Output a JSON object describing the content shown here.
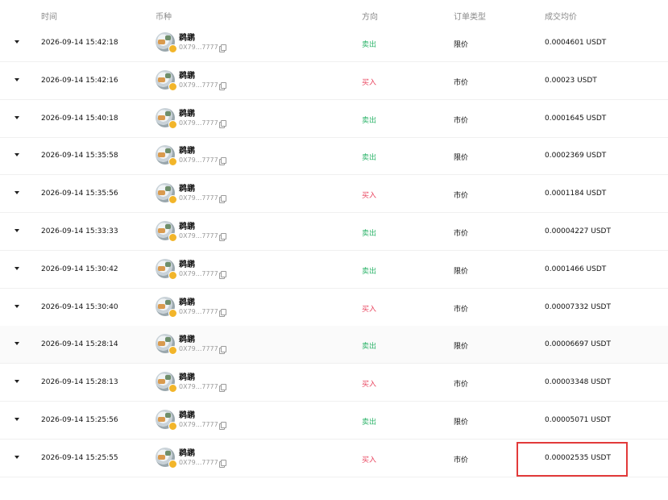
{
  "header": {
    "time": "时间",
    "coin": "币种",
    "direction": "方向",
    "order_type": "订单类型",
    "avg_price": "成交均价"
  },
  "colors": {
    "sell": "#2fb46b",
    "buy": "#e9445e",
    "highlight_box": "#e23a3a"
  },
  "rows": [
    {
      "time": "2026-09-14 15:42:18",
      "coin": "鹈鹕",
      "address": "0X79...7777",
      "direction": "卖出",
      "side": "sell",
      "order_type": "限价",
      "avg_price": "0.0004601 USDT"
    },
    {
      "time": "2026-09-14 15:42:16",
      "coin": "鹈鹕",
      "address": "0X79...7777",
      "direction": "买入",
      "side": "buy",
      "order_type": "市价",
      "avg_price": "0.00023 USDT"
    },
    {
      "time": "2026-09-14 15:40:18",
      "coin": "鹈鹕",
      "address": "0X79...7777",
      "direction": "卖出",
      "side": "sell",
      "order_type": "市价",
      "avg_price": "0.0001645 USDT"
    },
    {
      "time": "2026-09-14 15:35:58",
      "coin": "鹈鹕",
      "address": "0X79...7777",
      "direction": "卖出",
      "side": "sell",
      "order_type": "限价",
      "avg_price": "0.0002369 USDT"
    },
    {
      "time": "2026-09-14 15:35:56",
      "coin": "鹈鹕",
      "address": "0X79...7777",
      "direction": "买入",
      "side": "buy",
      "order_type": "市价",
      "avg_price": "0.0001184 USDT"
    },
    {
      "time": "2026-09-14 15:33:33",
      "coin": "鹈鹕",
      "address": "0X79...7777",
      "direction": "卖出",
      "side": "sell",
      "order_type": "市价",
      "avg_price": "0.00004227 USDT"
    },
    {
      "time": "2026-09-14 15:30:42",
      "coin": "鹈鹕",
      "address": "0X79...7777",
      "direction": "卖出",
      "side": "sell",
      "order_type": "限价",
      "avg_price": "0.0001466 USDT"
    },
    {
      "time": "2026-09-14 15:30:40",
      "coin": "鹈鹕",
      "address": "0X79...7777",
      "direction": "买入",
      "side": "buy",
      "order_type": "市价",
      "avg_price": "0.00007332 USDT"
    },
    {
      "time": "2026-09-14 15:28:14",
      "coin": "鹈鹕",
      "address": "0X79...7777",
      "direction": "卖出",
      "side": "sell",
      "order_type": "限价",
      "avg_price": "0.00006697 USDT"
    },
    {
      "time": "2026-09-14 15:28:13",
      "coin": "鹈鹕",
      "address": "0X79...7777",
      "direction": "买入",
      "side": "buy",
      "order_type": "市价",
      "avg_price": "0.00003348 USDT"
    },
    {
      "time": "2026-09-14 15:25:56",
      "coin": "鹈鹕",
      "address": "0X79...7777",
      "direction": "卖出",
      "side": "sell",
      "order_type": "限价",
      "avg_price": "0.00005071 USDT"
    },
    {
      "time": "2026-09-14 15:25:55",
      "coin": "鹈鹕",
      "address": "0X79...7777",
      "direction": "买入",
      "side": "buy",
      "order_type": "市价",
      "avg_price": "0.00002535 USDT"
    }
  ]
}
